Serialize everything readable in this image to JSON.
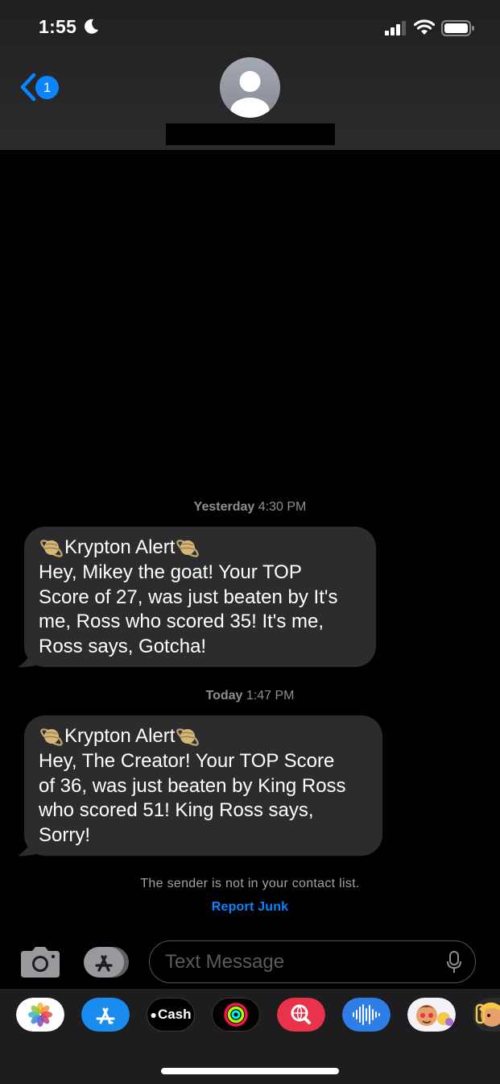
{
  "status_bar": {
    "time": "1:55"
  },
  "nav": {
    "back_badge": "1"
  },
  "messages": [
    {
      "timestamp_day": "Yesterday",
      "timestamp_time": "4:30 PM",
      "alert_title": "Krypton Alert",
      "body_lines": [
        "Hey, Mikey the goat! Your TOP",
        "Score of 27, was just beaten by It's",
        "me, Ross  who scored 35! It's me,",
        "Ross  says, Gotcha!"
      ]
    },
    {
      "timestamp_day": "Today",
      "timestamp_time": "1:47 PM",
      "alert_title": "Krypton Alert",
      "body_lines": [
        "Hey, The Creator! Your TOP Score",
        "of 36, was just beaten by King Ross",
        "who scored 51! King Ross says,",
        "Sorry!"
      ]
    }
  ],
  "notice": {
    "text": "The sender is not in your contact list.",
    "report_label": "Report Junk"
  },
  "input": {
    "placeholder": "Text Message"
  },
  "app_strip": {
    "cash_label": "Cash"
  },
  "colors": {
    "accent": "#0a84ff",
    "bubble": "#2c2c2e",
    "background": "#000000"
  }
}
